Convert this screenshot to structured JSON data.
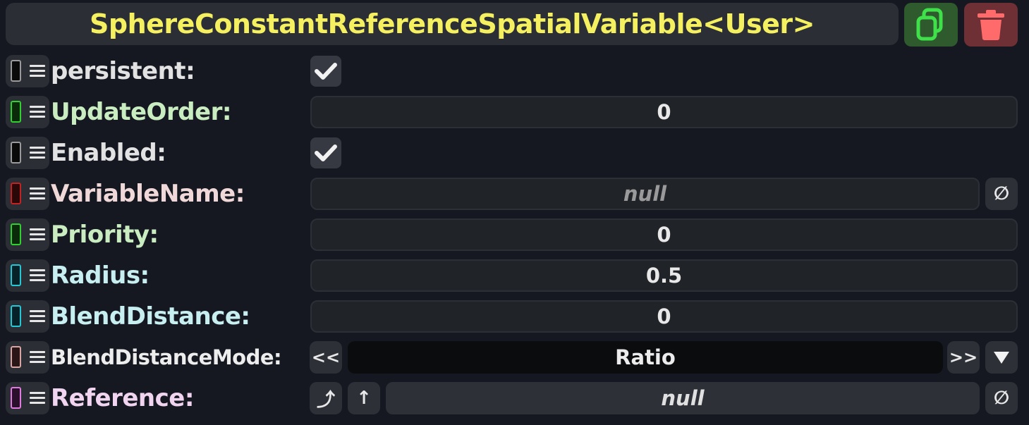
{
  "header": {
    "title": "SphereConstantReferenceSpatialVariable<User>",
    "title_color": "#f5f060",
    "duplicate_icon": "duplicate-icon",
    "delete_icon": "trash-icon"
  },
  "fields": [
    {
      "label": "persistent:",
      "label_color": "#e2e2e2",
      "swatch_color": "#9a9a9a",
      "kind": "checkbox",
      "checked": true
    },
    {
      "label": "UpdateOrder:",
      "label_color": "#c9edc0",
      "swatch_color": "#2ed12e",
      "kind": "number",
      "value": "0"
    },
    {
      "label": "Enabled:",
      "label_color": "#e2e2e2",
      "swatch_color": "#9a9a9a",
      "kind": "checkbox",
      "checked": true
    },
    {
      "label": "VariableName:",
      "label_color": "#f0d8d8",
      "swatch_color": "#c42222",
      "kind": "text",
      "value": "null",
      "clear_icon": "null-icon"
    },
    {
      "label": "Priority:",
      "label_color": "#c9edc0",
      "swatch_color": "#2ed12e",
      "kind": "number",
      "value": "0"
    },
    {
      "label": "Radius:",
      "label_color": "#c7eef0",
      "swatch_color": "#22c8d6",
      "kind": "number",
      "value": "0.5"
    },
    {
      "label": "BlendDistance:",
      "label_color": "#c7eef0",
      "swatch_color": "#22c8d6",
      "kind": "number",
      "value": "0"
    },
    {
      "label": "BlendDistanceMode:",
      "label_color": "#ededed",
      "swatch_color": "#d9a4a4",
      "kind": "enum",
      "value": "Ratio",
      "prev_label": "<<",
      "next_label": ">>",
      "dropdown_icon": "triangle-down-icon"
    },
    {
      "label": "Reference:",
      "label_color": "#f0d4f0",
      "swatch_color": "#e07ae0",
      "kind": "reference",
      "value": "null",
      "jump_icon": "jump-to-icon",
      "up_icon": "up-arrow-icon",
      "clear_icon": "null-icon"
    }
  ],
  "glyphs": {
    "null": "∅",
    "up": "↑",
    "jump": "⤴"
  }
}
